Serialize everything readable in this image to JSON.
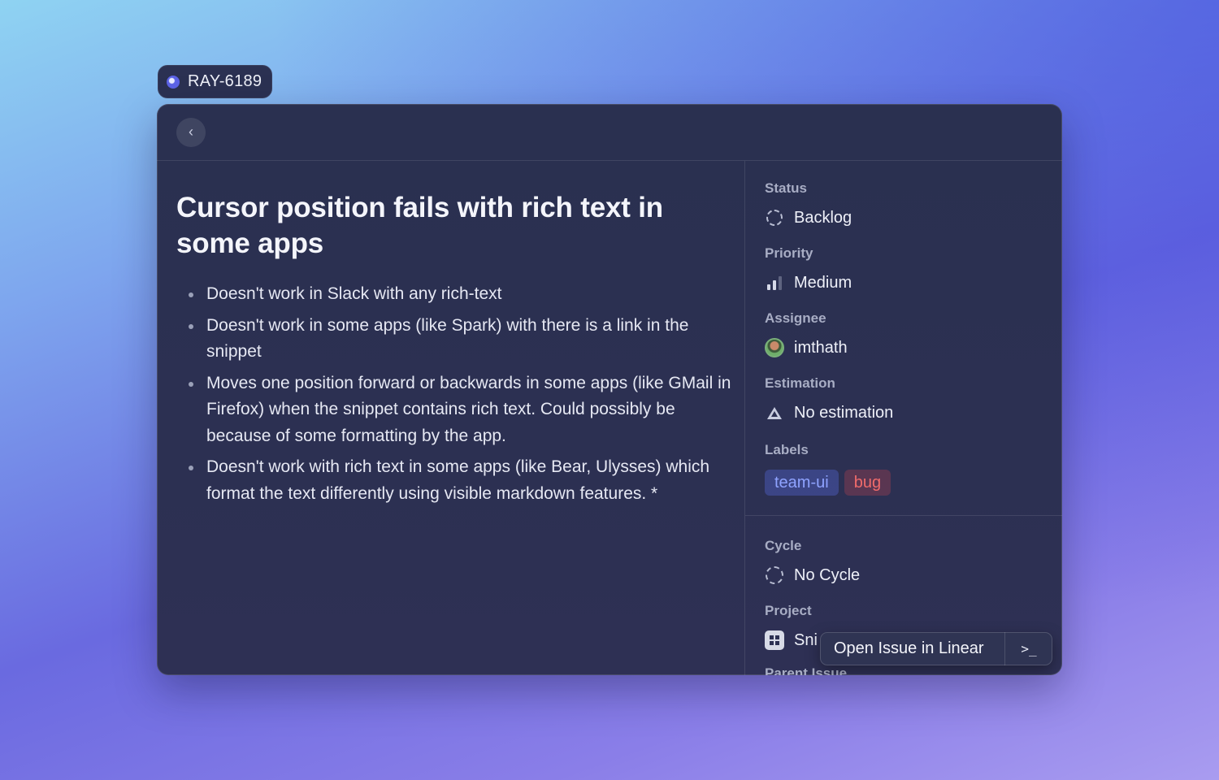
{
  "tag": {
    "id": "RAY-6189"
  },
  "window": {
    "back_icon": "chevron-left-icon",
    "issue": {
      "title": "Cursor position fails with rich text in some apps",
      "bullets": [
        "Doesn't work in Slack with any rich-text",
        "Doesn't work in some apps (like Spark) with there is a link in the snippet",
        "Moves one position forward or backwards in some apps (like GMail in Firefox) when the snippet contains rich text. Could possibly be because of some formatting by the app.",
        "Doesn't work with rich text in some apps (like Bear, Ulysses) which format the text differently using visible markdown features. *"
      ]
    },
    "sidebar": {
      "status": {
        "label": "Status",
        "value": "Backlog",
        "icon": "dashed-circle-icon"
      },
      "priority": {
        "label": "Priority",
        "value": "Medium",
        "icon": "signal-bars-icon",
        "level": 2,
        "max": 3
      },
      "assignee": {
        "label": "Assignee",
        "value": "imthath",
        "icon": "avatar"
      },
      "estimation": {
        "label": "Estimation",
        "value": "No estimation",
        "icon": "triangle-icon"
      },
      "labels": {
        "label": "Labels",
        "items": [
          {
            "name": "team-ui",
            "color": "#8fa3ff"
          },
          {
            "name": "bug",
            "color": "#f06b6b"
          }
        ]
      },
      "cycle": {
        "label": "Cycle",
        "value": "No Cycle",
        "icon": "dashed-circle-icon"
      },
      "project": {
        "label": "Project",
        "value": "Sni",
        "icon": "project-grid-icon"
      },
      "parent_issue": {
        "label": "Parent Issue"
      }
    },
    "action_panel": {
      "primary": "Open Issue in Linear",
      "secondary": ">_"
    }
  }
}
